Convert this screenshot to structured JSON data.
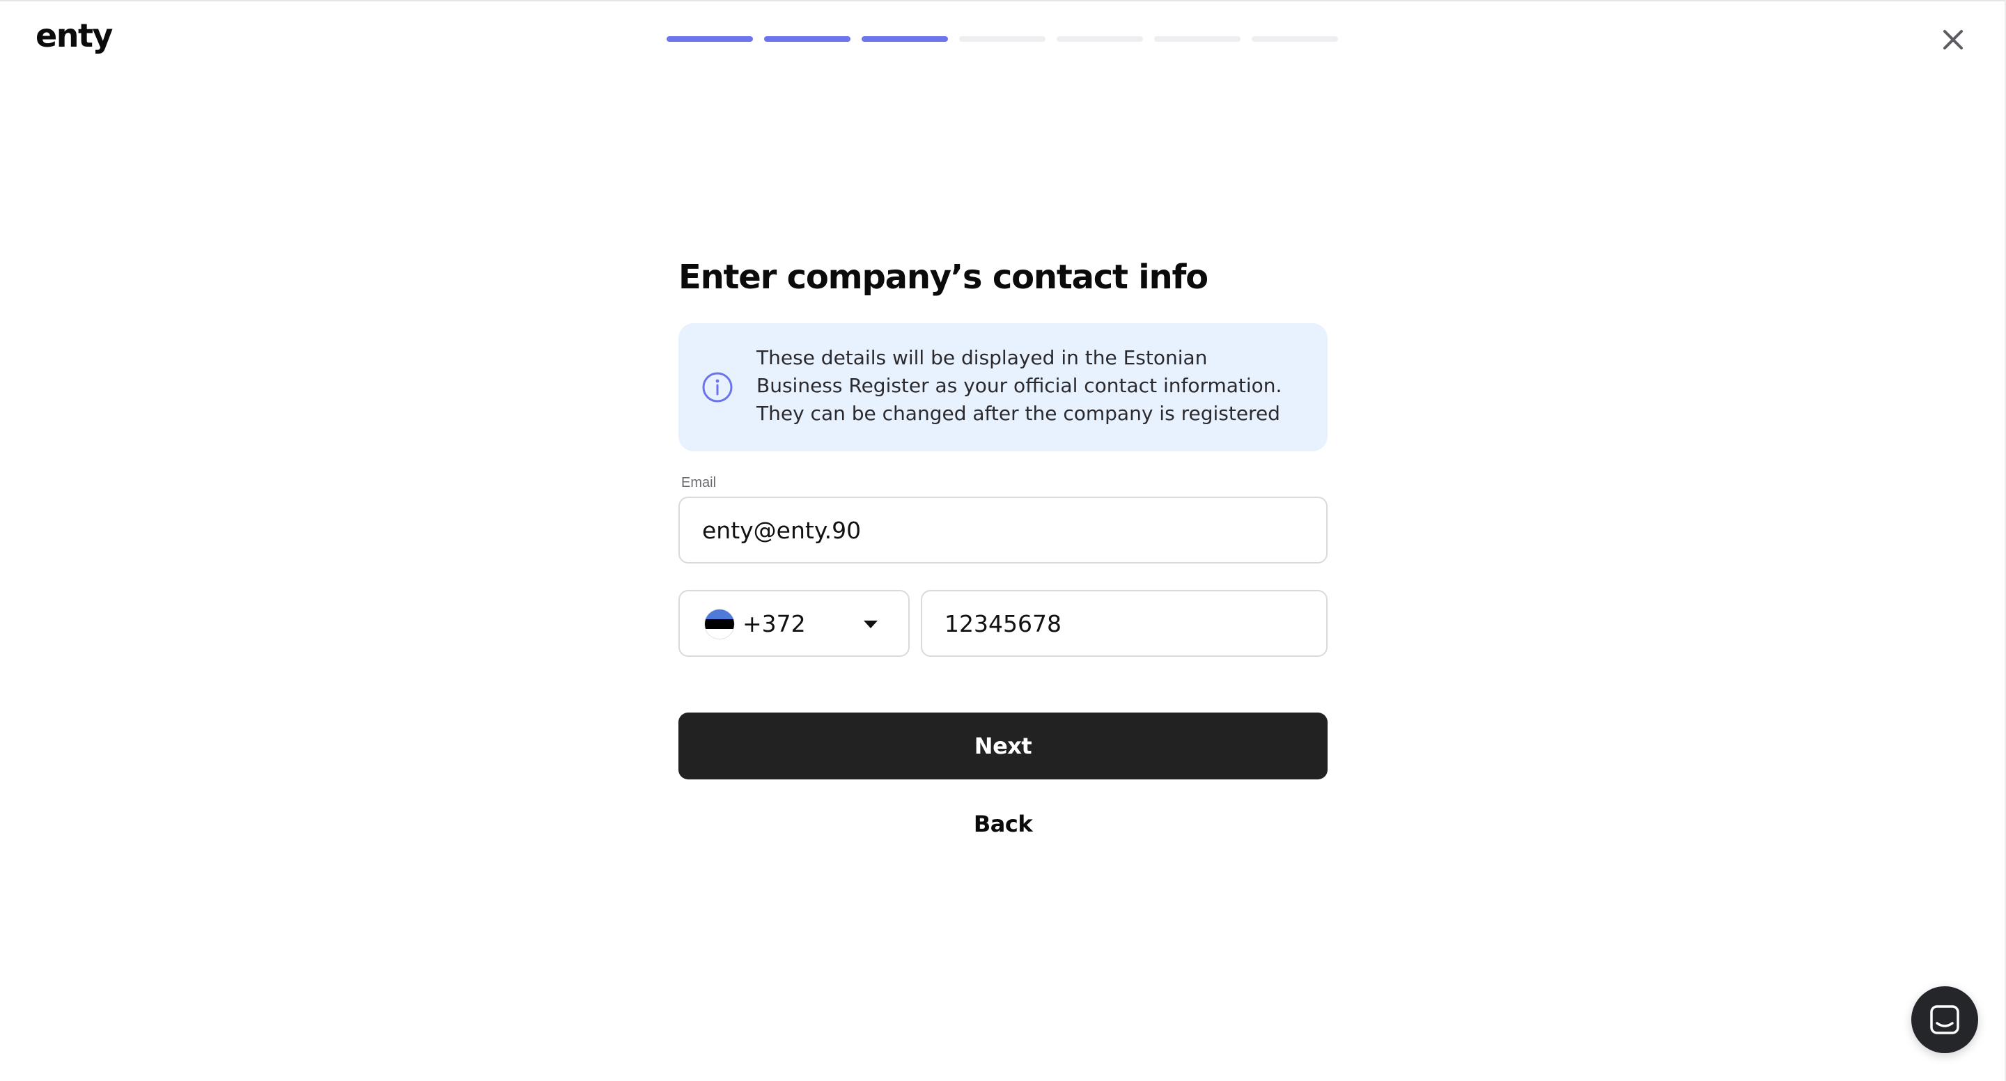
{
  "header": {
    "logo": "enty",
    "progress": {
      "total_steps": 7,
      "completed_steps": 3
    },
    "close_icon": "close-icon"
  },
  "main": {
    "title": "Enter company’s contact info",
    "info": {
      "icon": "info-icon",
      "text": "These details will be displayed in the Estonian Business Register as your official contact information. They can be changed after the company is registered"
    },
    "email": {
      "label": "Email",
      "value": "enty@enty.90"
    },
    "phone": {
      "country_flag": "estonia-flag-icon",
      "country_code": "+372",
      "number": "12345678"
    },
    "next_label": "Next",
    "back_label": "Back"
  },
  "chat": {
    "icon": "chat-icon"
  },
  "colors": {
    "accent": "#6b74ea",
    "progress_inactive": "#eeeef1",
    "info_background": "#e8f1fe",
    "primary_button": "#222222"
  }
}
